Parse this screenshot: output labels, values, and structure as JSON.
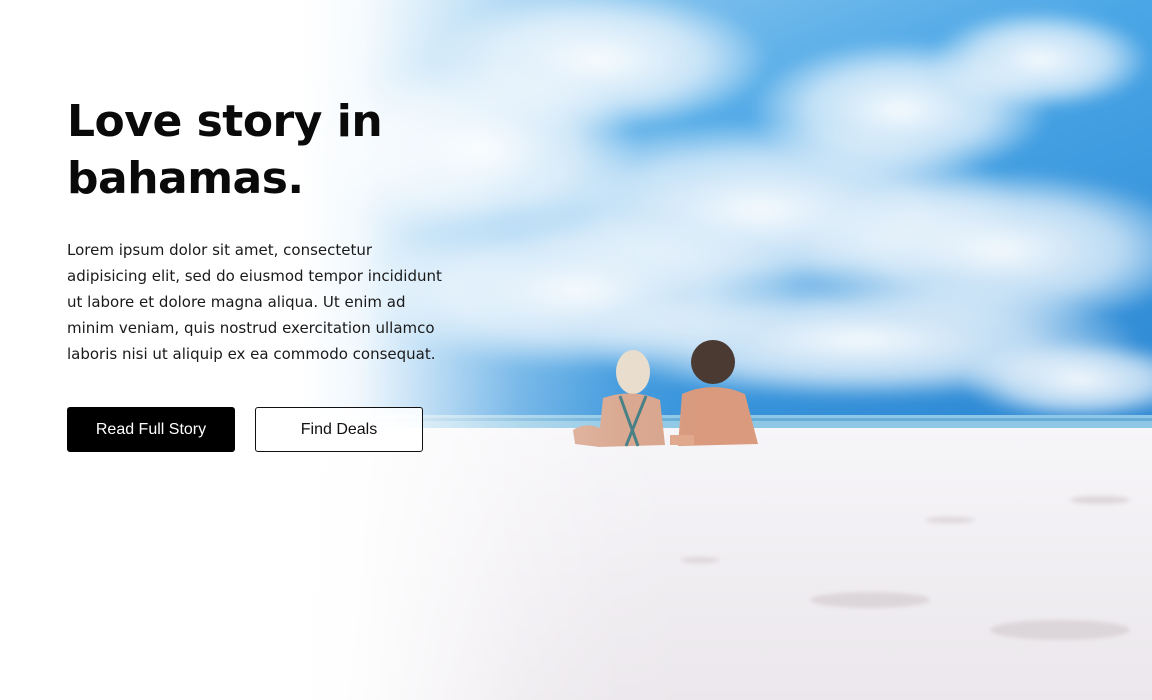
{
  "hero": {
    "title": "Love story in bahamas.",
    "description": "Lorem ipsum dolor sit amet, consectetur adipisicing elit, sed do eiusmod tempor incididunt ut labore et dolore magna aliqua. Ut enim ad minim veniam, quis nostrud exercitation ullamco laboris nisi ut aliquip ex ea commodo consequat.",
    "primary_button_label": "Read Full Story",
    "secondary_button_label": "Find Deals"
  },
  "colors": {
    "primary_button_bg": "#000000",
    "primary_button_text": "#ffffff",
    "sky_blue": "#2f8fd8",
    "sand": "#f1eff3"
  }
}
